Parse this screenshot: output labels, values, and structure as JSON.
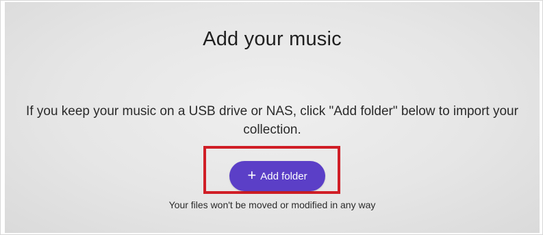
{
  "dialog": {
    "title": "Add your music",
    "description": "If you keep your music on a USB drive or NAS, click \"Add folder\" below to import your collection.",
    "add_folder": {
      "icon": "plus-icon",
      "icon_glyph": "+",
      "label": "Add folder"
    },
    "note": "Your files won't be moved or modified in any way"
  },
  "colors": {
    "button": "#5b3fc7",
    "highlight_box": "#d01e26"
  }
}
